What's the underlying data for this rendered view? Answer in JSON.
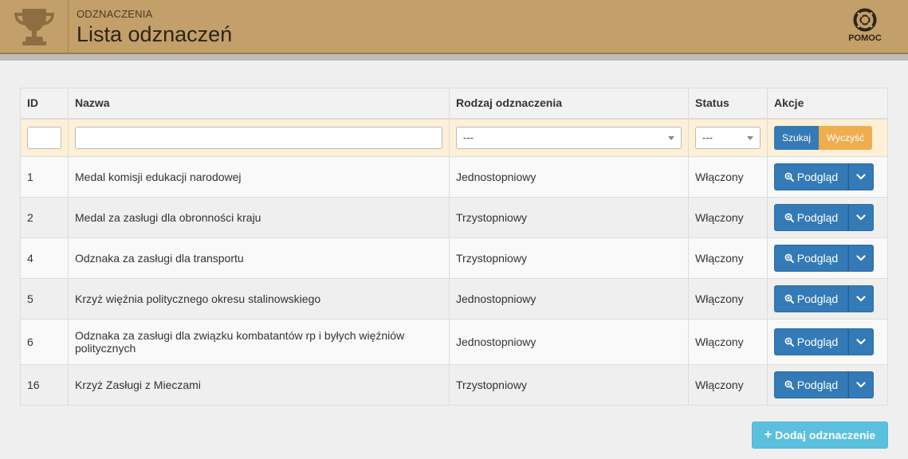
{
  "header": {
    "subtitle": "ODZNACZENIA",
    "title": "Lista odznaczeń",
    "help_label": "POMOC",
    "brand_color": "#c39f6a"
  },
  "table": {
    "columns": [
      "ID",
      "Nazwa",
      "Rodzaj odznaczenia",
      "Status",
      "Akcje"
    ],
    "filters": {
      "id_value": "",
      "name_value": "",
      "type_selected": "---",
      "status_selected": "---",
      "search_label": "Szukaj",
      "clear_label": "Wyczyść"
    },
    "rows": [
      {
        "id": "1",
        "name": "Medal komisji edukacji narodowej",
        "type": "Jednostopniowy",
        "status": "Włączony",
        "action": "Podgląd"
      },
      {
        "id": "2",
        "name": "Medal za zasługi dla obronności kraju",
        "type": "Trzystopniowy",
        "status": "Włączony",
        "action": "Podgląd"
      },
      {
        "id": "4",
        "name": "Odznaka za zasługi dla transportu",
        "type": "Trzystopniowy",
        "status": "Włączony",
        "action": "Podgląd"
      },
      {
        "id": "5",
        "name": "Krzyż więźnia politycznego okresu stalinowskiego",
        "type": "Jednostopniowy",
        "status": "Włączony",
        "action": "Podgląd"
      },
      {
        "id": "6",
        "name": "Odznaka za zasługi dla związku kombatantów rp i byłych więźniów politycznych",
        "type": "Jednostopniowy",
        "status": "Włączony",
        "action": "Podgląd"
      },
      {
        "id": "16",
        "name": "Krzyż Zasługi z Mieczami",
        "type": "Trzystopniowy",
        "status": "Włączony",
        "action": "Podgląd"
      }
    ]
  },
  "add_button": {
    "label": "Dodaj odznaczenie"
  },
  "colors": {
    "primary": "#337ab7",
    "warning": "#f0ad4e",
    "info": "#5bc0de",
    "status_enabled": "#3c9a3c"
  }
}
